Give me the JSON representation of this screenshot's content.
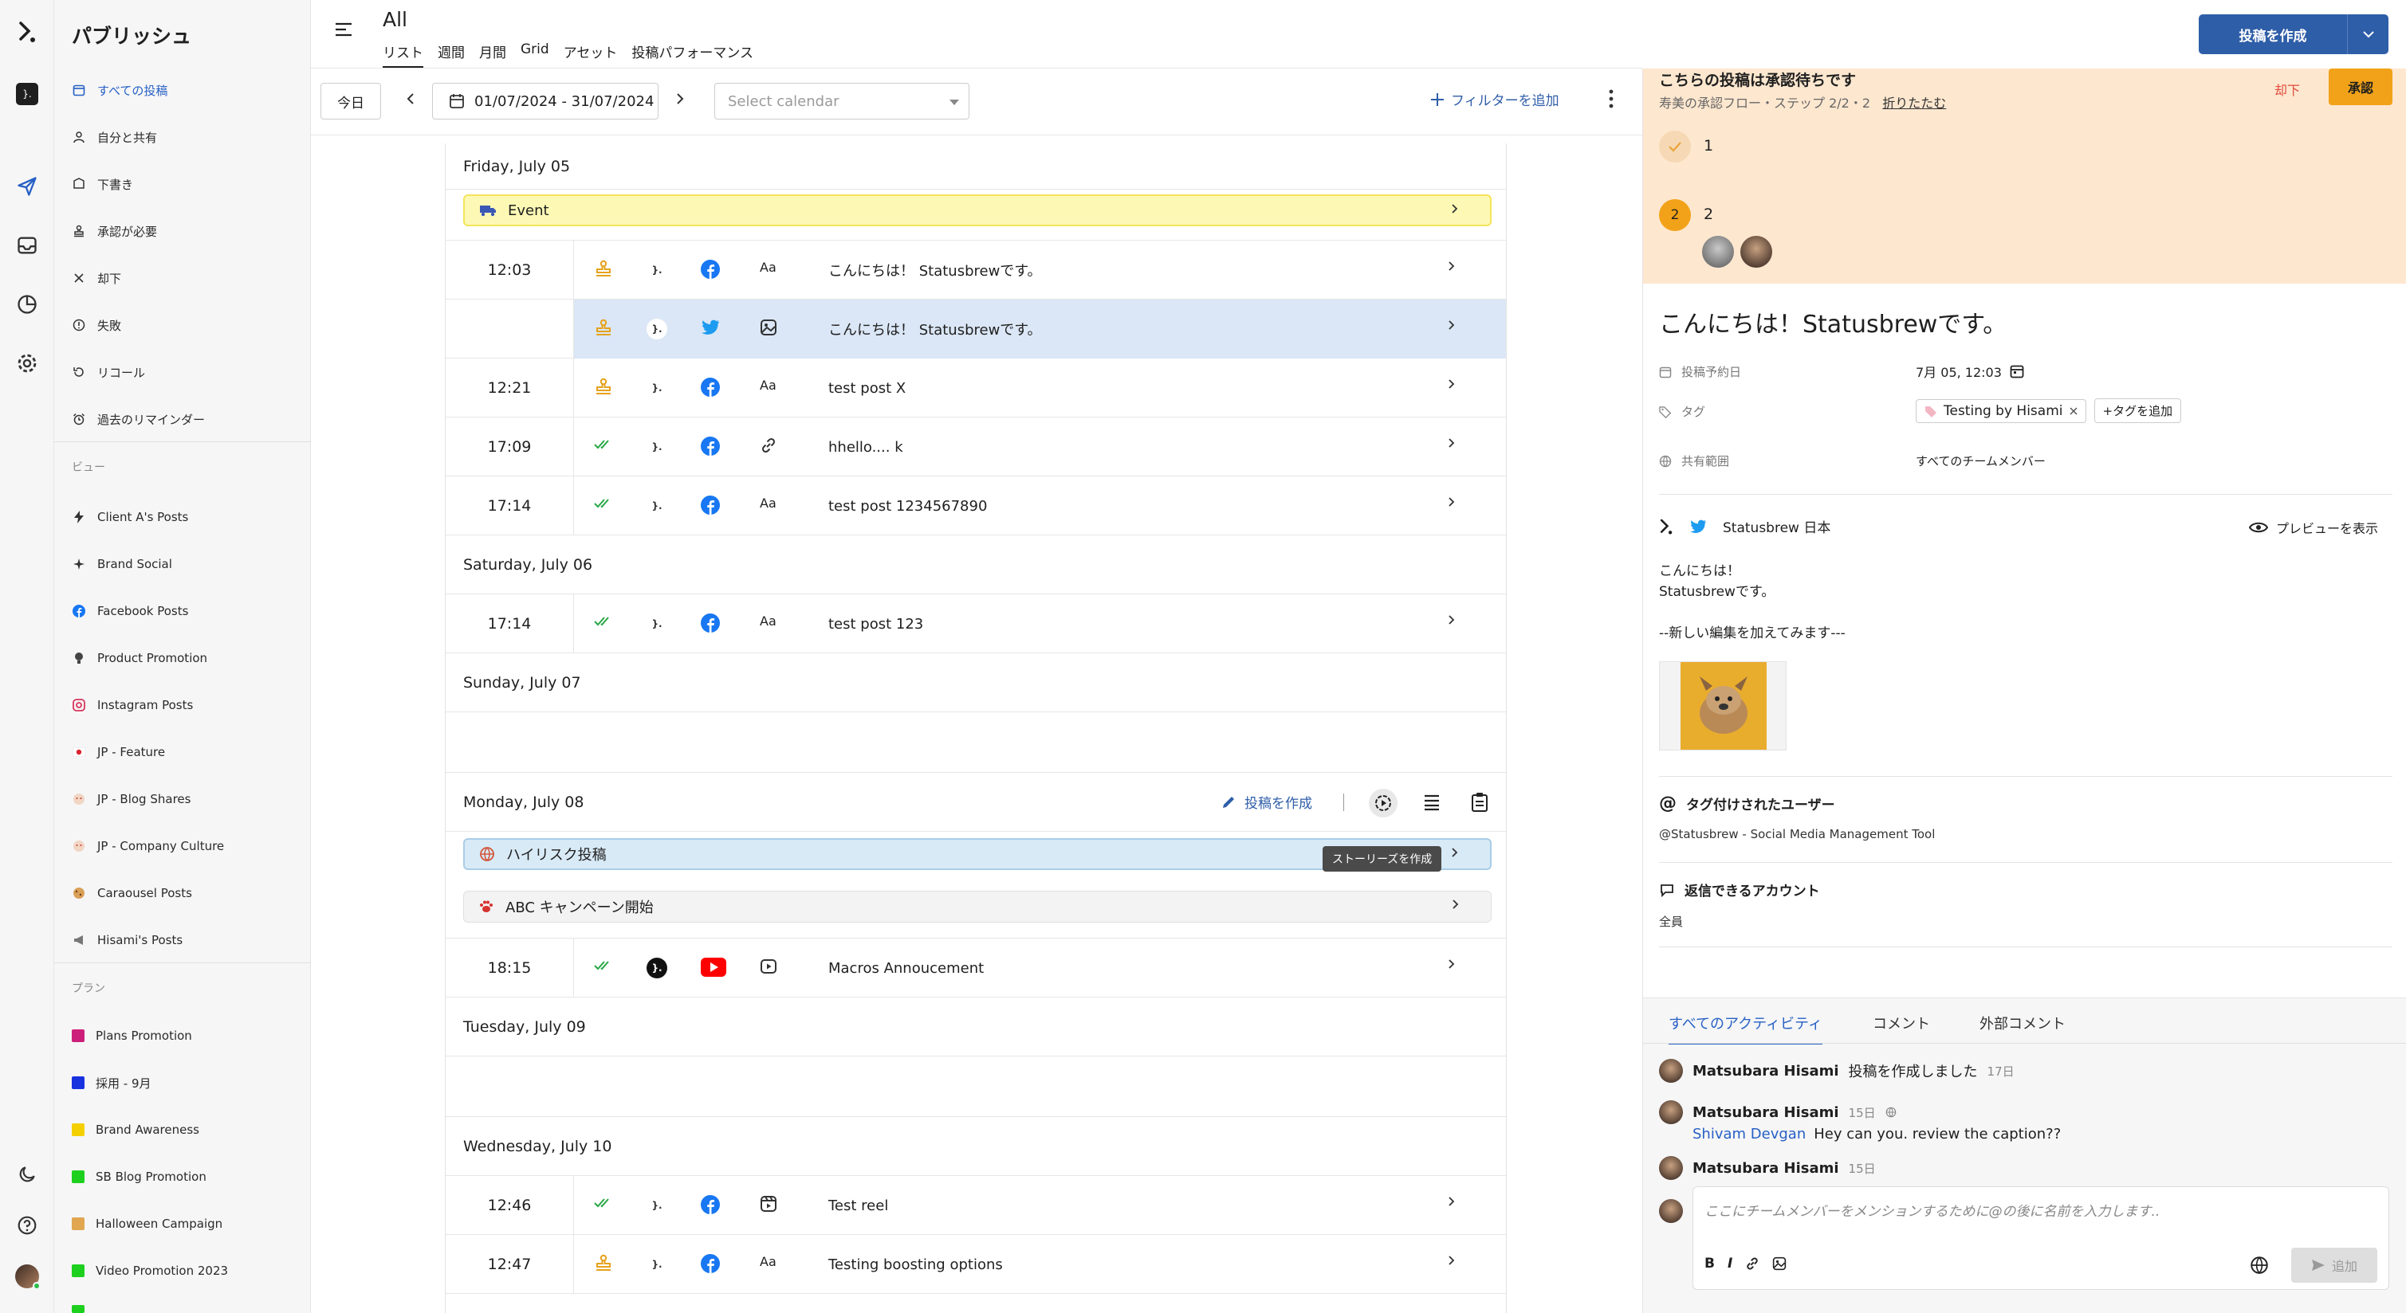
{
  "app": {
    "logo_text": "}."
  },
  "sidebar": {
    "title": "パブリッシュ",
    "nav": [
      {
        "label": "すべての投稿",
        "icon": "calendar-icon",
        "active": true
      },
      {
        "label": "自分と共有",
        "icon": "person-icon"
      },
      {
        "label": "下書き",
        "icon": "draft-icon"
      },
      {
        "label": "承認が必要",
        "icon": "stamp-icon"
      },
      {
        "label": "却下",
        "icon": "x-icon"
      },
      {
        "label": "失敗",
        "icon": "alert-icon"
      },
      {
        "label": "リコール",
        "icon": "recall-icon"
      },
      {
        "label": "過去のリマインダー",
        "icon": "alarm-icon"
      }
    ],
    "views_label": "ビュー",
    "views": [
      {
        "label": "Client A's Posts",
        "icon": "bolt-icon"
      },
      {
        "label": "Brand Social",
        "icon": "sparkle-icon"
      },
      {
        "label": "Facebook Posts",
        "icon": "facebook-icon"
      },
      {
        "label": "Product Promotion",
        "icon": "bulb-icon"
      },
      {
        "label": "Instagram Posts",
        "icon": "instagram-icon"
      },
      {
        "label": "JP - Feature",
        "icon": "japan-flag-icon"
      },
      {
        "label": "JP - Blog Shares",
        "icon": "face-icon"
      },
      {
        "label": "JP - Company Culture",
        "icon": "face-icon"
      },
      {
        "label": "Caraousel Posts",
        "icon": "cookie-icon"
      },
      {
        "label": "Hisami's Posts",
        "icon": "megaphone-icon"
      }
    ],
    "plans_label": "プラン",
    "plans": [
      {
        "label": "Plans Promotion",
        "color": "#cc1f7a"
      },
      {
        "label": "採用 - 9月",
        "color": "#1832e0"
      },
      {
        "label": "Brand Awareness",
        "color": "#f5d000"
      },
      {
        "label": "SB Blog Promotion",
        "color": "#1ed01e"
      },
      {
        "label": "Halloween Campaign",
        "color": "#e0a650"
      },
      {
        "label": "Video Promotion 2023",
        "color": "#1ed01e"
      }
    ]
  },
  "header": {
    "title": "All",
    "tabs": [
      "リスト",
      "週間",
      "月間",
      "Grid",
      "アセット",
      "投稿パフォーマンス"
    ],
    "create_label": "投稿を作成"
  },
  "toolbar": {
    "today": "今日",
    "range": "01/07/2024 - 31/07/2024",
    "calendar_placeholder": "Select calendar",
    "filter": "フィルターを追加"
  },
  "list": {
    "days": {
      "fri": "Friday, July 05",
      "sat": "Saturday, July 06",
      "sun": "Sunday, July 07",
      "mon": "Monday, July 08",
      "tue": "Tuesday, July 09",
      "wed": "Wednesday, July 10"
    },
    "event_chip": "Event",
    "highrisk_chip": "ハイリスク投稿",
    "abc_chip": "ABC キャンペーン開始",
    "mon_create": "投稿を作成",
    "tooltip": "ストーリーズを作成",
    "rows": [
      {
        "time": "12:03",
        "text": "こんにちは！ Statusbrewです。",
        "status": "stamp-icon",
        "network": "facebook-icon",
        "type": "Aa"
      },
      {
        "time": "",
        "text": "こんにちは！ Statusbrewです。",
        "status": "stamp-icon",
        "network": "twitter-icon",
        "type": "image"
      },
      {
        "time": "12:21",
        "text": "test post X",
        "status": "stamp-icon",
        "network": "facebook-icon",
        "type": "Aa"
      },
      {
        "time": "17:09",
        "text": "hhello.... k",
        "status": "double-check-icon",
        "network": "facebook-icon",
        "type": "link"
      },
      {
        "time": "17:14",
        "text": "test post 1234567890",
        "status": "double-check-icon",
        "network": "facebook-icon",
        "type": "Aa"
      },
      {
        "time": "17:14",
        "text": "test post 123",
        "status": "double-check-icon",
        "network": "facebook-icon",
        "type": "Aa"
      },
      {
        "time": "18:15",
        "text": "Macros Annoucement",
        "status": "double-check-icon",
        "network": "youtube-icon",
        "type": "video"
      },
      {
        "time": "12:46",
        "text": "Test reel",
        "status": "double-check-icon",
        "network": "facebook-icon",
        "type": "reel"
      },
      {
        "time": "12:47",
        "text": "Testing boosting options",
        "status": "stamp-icon",
        "network": "facebook-icon",
        "type": "Aa"
      }
    ]
  },
  "panel": {
    "approval_title": "こちらの投稿は承認待ちです",
    "approval_sub": "寿美の承認フロー・ステップ 2/2・2",
    "collapse": "折りたたむ",
    "reject": "却下",
    "approve": "承認",
    "step1": "1",
    "step2": "2",
    "post_title": "こんにちは！Statusbrewです。",
    "schedule_label": "投稿予約日",
    "schedule_value": "7月 05, 12:03",
    "tag_label": "タグ",
    "tag_value": "Testing by Hisami",
    "add_tag": "+タグを追加",
    "share_label": "共有範囲",
    "share_value": "すべてのチームメンバー",
    "account_name": "Statusbrew 日本",
    "preview": "プレビューを表示",
    "body_line1": "こんにちは！",
    "body_line2": "Statusbrewです。",
    "body_line3": "--新しい編集を加えてみます---",
    "tagged_users_h": "タグ付けされたユーザー",
    "tagged_users_v": "@Statusbrew - Social Media Management Tool",
    "reply_h": "返信できるアカウント",
    "reply_v": "全員",
    "activity_tabs": [
      "すべてのアクティビティ",
      "コメント",
      "外部コメント"
    ],
    "act1_name": "Matsubara Hisami",
    "act1_action": "投稿を作成しました",
    "act1_time": "17日",
    "act2_name": "Matsubara Hisami",
    "act2_time": "15日",
    "act2_mention": "Shivam Devgan",
    "act2_text": "Hey can you. review the caption??",
    "act3_name": "Matsubara Hisami",
    "act3_time": "15日",
    "composer_placeholder": "ここにチームメンバーをメンションするために@の後に名前を入力します..",
    "send": "追加"
  }
}
